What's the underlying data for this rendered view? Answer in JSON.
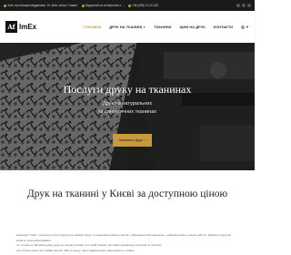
{
  "topbar": {
    "address": "Київ, вул.Машинобудівників, 10. Київ, метро \"Нивки\"",
    "hours": "Відкритий за телефоном з ...",
    "phone": "+38 (098) 70-22-422"
  },
  "brand": {
    "mark": "Af",
    "name": "ImEx"
  },
  "nav": {
    "items": [
      {
        "label": "ГОЛОВНА",
        "active": true
      },
      {
        "label": "ДРУК НА ТКАНИНІ",
        "dropdown": true
      },
      {
        "label": "ТКАНИНИ"
      },
      {
        "label": "ЦІНИ НА ДРУК"
      },
      {
        "label": "КОНТАКТИ"
      }
    ],
    "lang": "ua"
  },
  "hero": {
    "title": "Послуги друку на тканинах",
    "subtitle_line1": "Друк на натуральних",
    "subtitle_line2": "та синтетичних тканинах",
    "button_label": "Замовити Друк"
  },
  "section": {
    "title": "Друк на тканині у Києві за доступною ціною",
    "line1": "Компанія \"ImEx\" пропонує послуги друку на тканині. Будь-то невелика кількість метрів, зображення або малюнок—найкраща якість нашої роботи. Замовити друк ви можете зателефонувавши",
    "line2": "по телефону. Ми виконуємо друк на тканині в Києві та по всій Україні, доставка замовлень кур'єром та поштою.",
    "line3": "доступною ціною без зайвих витрат. Якість друку і ціни задовольнять ваші вимоги. «ImEx»."
  },
  "colors": {
    "accent": "#c69a3d",
    "topbar": "#1b1b1b"
  },
  "icons": {
    "location": "location-icon",
    "clock": "clock-icon",
    "phone": "phone-icon",
    "globe": "globe-icon",
    "arrow": "arrow-right-icon"
  }
}
